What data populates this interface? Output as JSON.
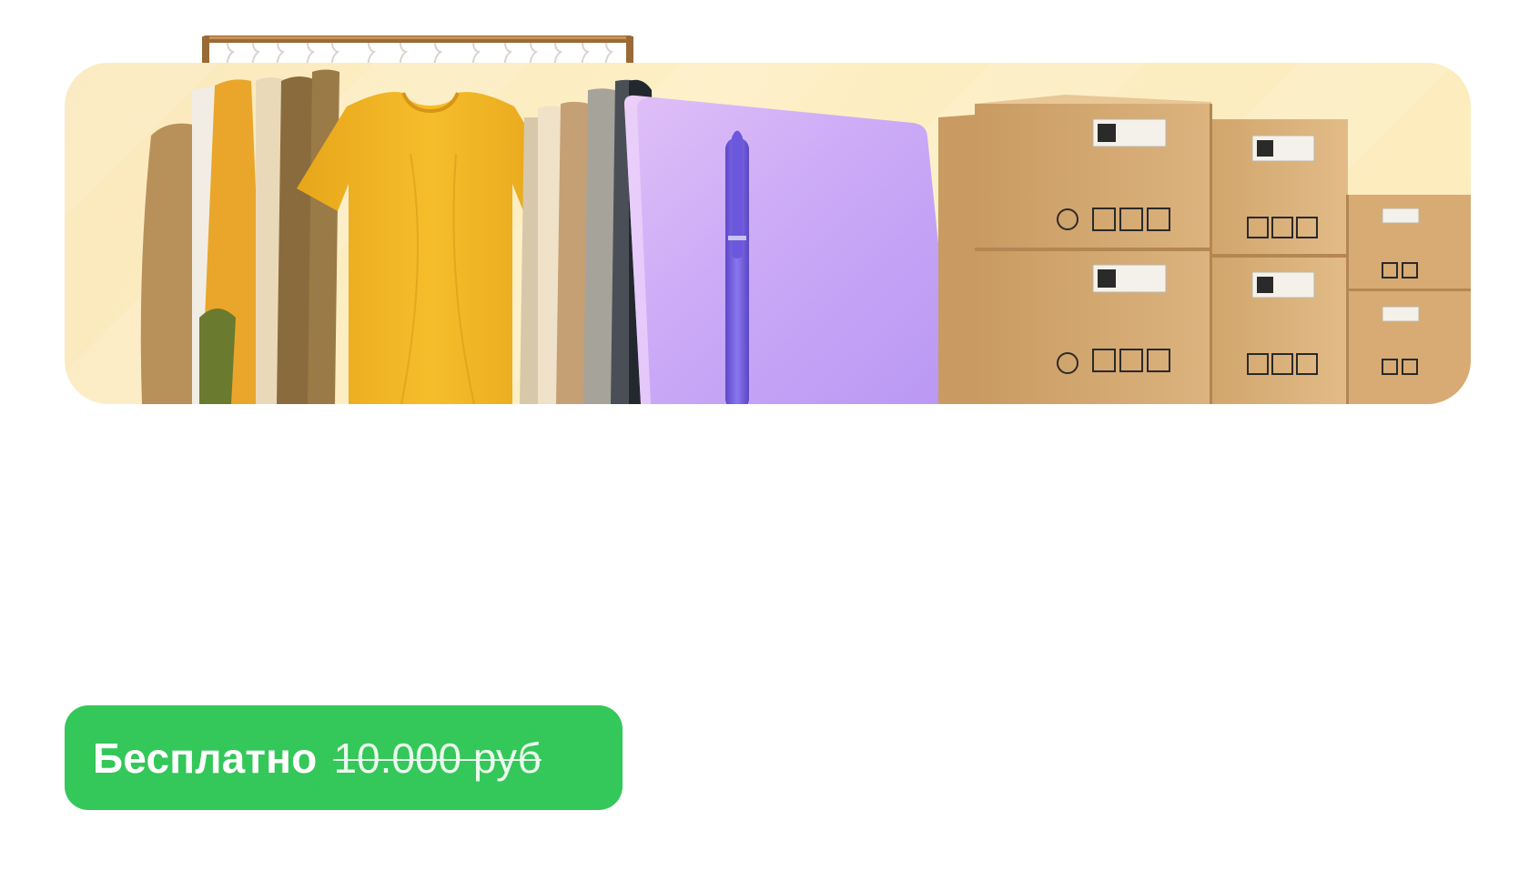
{
  "colors": {
    "banner_bg": "#fdefc4",
    "badge_bg": "#34c759",
    "badge_text": "#ffffff",
    "shirt_yellow": "#f2b51f",
    "folder_purple": "#c7a6f7",
    "pen_purple": "#7b63e6",
    "box_kraft": "#d9b07a"
  },
  "hero": {
    "illustration": [
      "clothing-rack",
      "yellow-tshirt",
      "purple-folder",
      "pen",
      "cardboard-boxes"
    ]
  },
  "price": {
    "free_label": "Бесплатно",
    "old_price": "10.000 руб"
  }
}
